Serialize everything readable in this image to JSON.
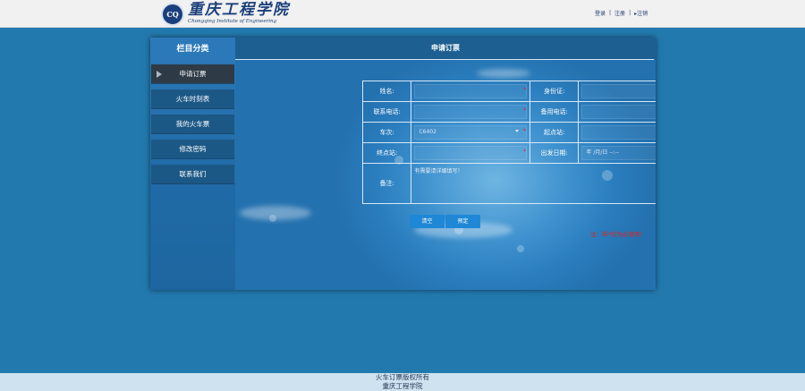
{
  "header": {
    "logo_text_cn": "重庆工程学院",
    "logo_text_en": "Chongqing Institute of Engineering",
    "logo_emblem": "CQ",
    "links": [
      "登录",
      "注册",
      "▸注销"
    ]
  },
  "sidebar": {
    "title": "栏目分类",
    "items": [
      {
        "label": "申请订票",
        "active": true
      },
      {
        "label": "火车时刻表"
      },
      {
        "label": "我的火车票"
      },
      {
        "label": "修改密码"
      },
      {
        "label": "联系我们"
      }
    ]
  },
  "main": {
    "title": "申请订票",
    "form": {
      "name_label": "姓名:",
      "id_label": "身份证:",
      "phone_label": "联系电话:",
      "phone2_label": "备用电话:",
      "train_label": "车次:",
      "train_value": "C6402",
      "from_label": "起点站:",
      "to_label": "终点站:",
      "date_label": "出发日期:",
      "date_placeholder": "年 /月/日 --:--",
      "note_label": "备注:",
      "note_value": "有需要请详细填写！",
      "required_mark": "*"
    },
    "buttons": {
      "clear": "清空",
      "submit": "预定"
    },
    "error": "注：带*的为必填项！"
  },
  "footer": {
    "line1": "火车订票版权所有",
    "line2": "重庆工程学院"
  },
  "colors": {
    "page_bg": "#2279ae",
    "topbar_bg": "#f1f1f1",
    "active_nav": "#2e3b46",
    "error": "#e0241b"
  }
}
